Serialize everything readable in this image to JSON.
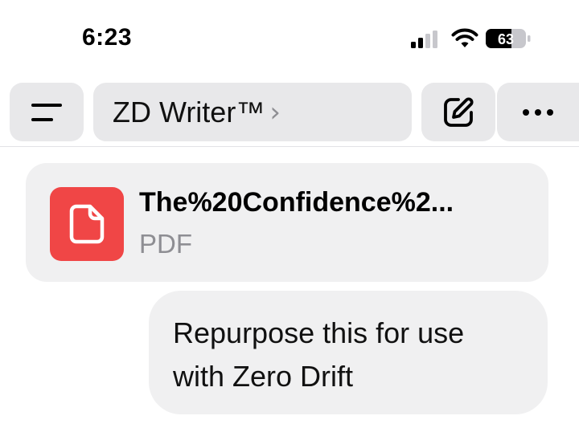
{
  "status_bar": {
    "time": "6:23",
    "battery_level": "63",
    "icons": [
      "cellular-signal-icon",
      "wifi-icon",
      "battery-icon"
    ]
  },
  "toolbar": {
    "menu_icon": "menu-icon",
    "title": "ZD Writer™",
    "chevron": "›",
    "edit_icon": "edit-icon",
    "more_icon": "more-icon"
  },
  "attachment": {
    "file_name": "The%20Confidence%2...",
    "file_type": "PDF",
    "icon": "document-icon",
    "icon_color": "#f04646"
  },
  "message": {
    "text": "Repurpose this for use with Zero Drift"
  }
}
